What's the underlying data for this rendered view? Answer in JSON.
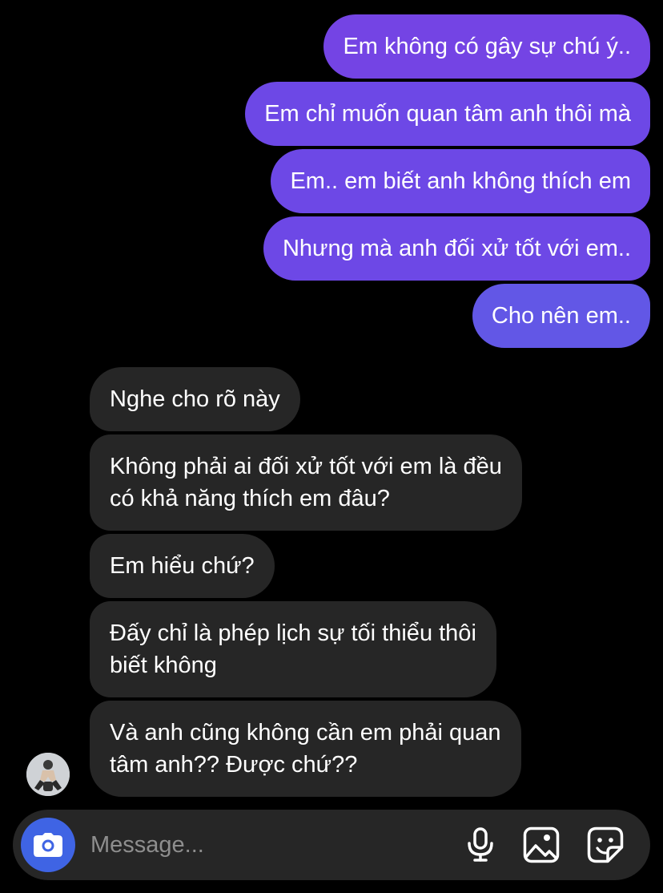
{
  "messages": {
    "sent": [
      "Em không có gây sự chú ý..",
      "Em chỉ muốn quan tâm anh thôi mà",
      "Em.. em biết anh không thích em",
      "Nhưng mà anh đối xử tốt với em..",
      "Cho nên em.."
    ],
    "received": [
      [
        "Nghe cho rõ này"
      ],
      [
        "Không phải ai đối xử tốt với em là đều",
        "có khả năng thích em đâu?"
      ],
      [
        "Em hiểu chứ?"
      ],
      [
        "Đấy chỉ là phép lịch sự tối thiểu thôi",
        "biết không"
      ],
      [
        "Và anh cũng không cần em phải quan",
        "tâm anh?? Được chứ??"
      ]
    ]
  },
  "composer": {
    "placeholder": "Message...",
    "icons": [
      "camera-icon",
      "microphone-icon",
      "image-gallery-icon",
      "sticker-icon"
    ]
  },
  "colors": {
    "background": "#000000",
    "sent_bubble": "#6d48e6",
    "received_bubble": "#262626",
    "composer": "#262626",
    "camera_button": "#3f64e4",
    "placeholder_text": "#8e8e8e"
  }
}
